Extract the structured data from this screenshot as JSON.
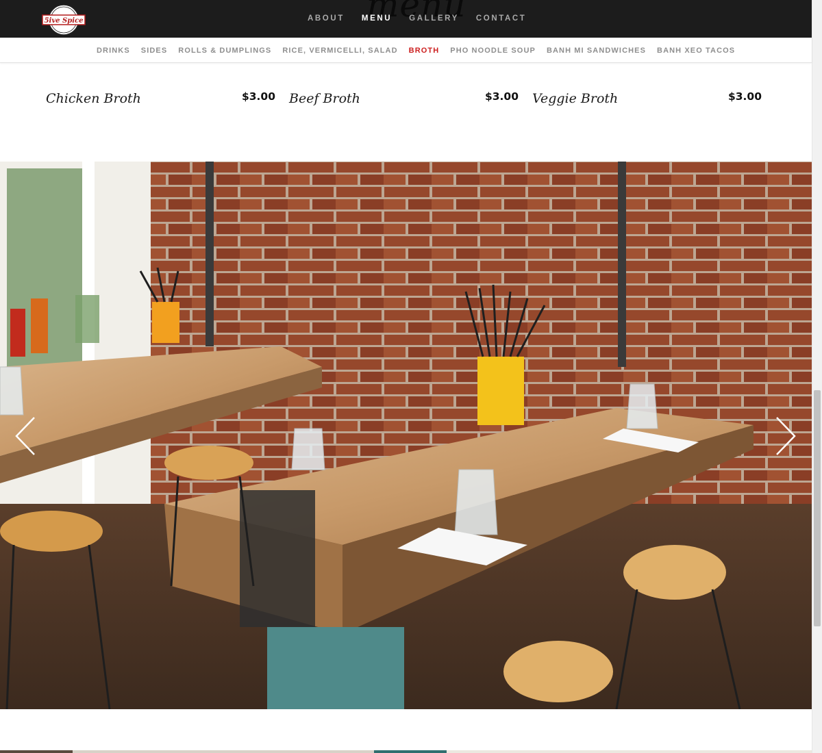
{
  "header": {
    "logo_text": "5ive Spice",
    "page_title": "menu",
    "nav": [
      {
        "label": "ABOUT",
        "active": false
      },
      {
        "label": "MENU",
        "active": true
      },
      {
        "label": "GALLERY",
        "active": false
      },
      {
        "label": "CONTACT",
        "active": false
      }
    ]
  },
  "subnav": {
    "items": [
      {
        "label": "DRINKS",
        "active": false
      },
      {
        "label": "SIDES",
        "active": false
      },
      {
        "label": "ROLLS & DUMPLINGS",
        "active": false
      },
      {
        "label": "RICE, VERMICELLI, SALAD",
        "active": false
      },
      {
        "label": "BROTH",
        "active": true
      },
      {
        "label": "PHO NOODLE SOUP",
        "active": false
      },
      {
        "label": "BANH MI SANDWICHES",
        "active": false
      },
      {
        "label": "BANH XEO TACOS",
        "active": false
      }
    ]
  },
  "menu": {
    "items": [
      {
        "name": "Chicken Broth",
        "price": "$3.00"
      },
      {
        "name": "Beef Broth",
        "price": "$3.00"
      },
      {
        "name": "Veggie Broth",
        "price": "$3.00"
      }
    ]
  },
  "slider": {
    "prev_icon": "chevron-left-icon",
    "next_icon": "chevron-right-icon",
    "photo_description_icon": "restaurant-interior-photo"
  },
  "colors": {
    "nav_bg": "#1c1c1c",
    "accent": "#cc1f1f",
    "nav_text": "#a9a9a9",
    "nav_active": "#ffffff"
  }
}
